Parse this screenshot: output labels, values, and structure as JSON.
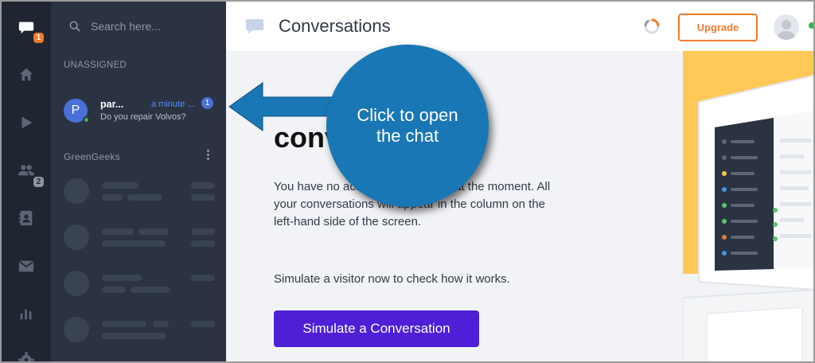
{
  "rail": {
    "chat_badge": "1",
    "team_badge": "2"
  },
  "search": {
    "placeholder": "Search here..."
  },
  "sections": {
    "unassigned": "UNASSIGNED",
    "group": "GreenGeeks"
  },
  "conversation": {
    "avatar_letter": "P",
    "name": "par...",
    "time": "a minute ...",
    "unread": "1",
    "message": "Do you repair Volvos?"
  },
  "header": {
    "title": "Conversations",
    "upgrade_label": "Upgrade"
  },
  "main": {
    "headline": "conv",
    "description": "You have no active conversations at the moment. All your conversations will appear in the column on the left-hand side of the screen.",
    "simulate_text": "Simulate a visitor now to check how it works.",
    "simulate_button": "Simulate a Conversation"
  },
  "callout": {
    "text": "Click to open the chat"
  },
  "colors": {
    "rail_bg": "#1f2531",
    "list_bg": "#2b3342",
    "accent_orange": "#f27b2b",
    "primary_button": "#4f1fd8",
    "callout_blue": "#1a77b5",
    "illustration_yellow": "#ffc857"
  }
}
